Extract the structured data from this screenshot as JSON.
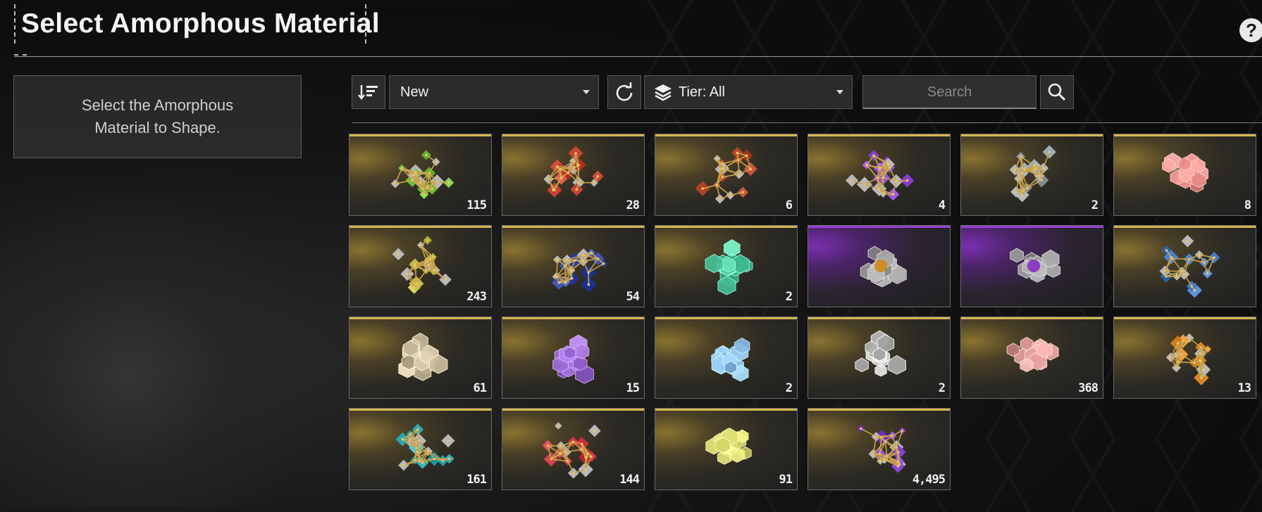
{
  "header": {
    "title": "Select Amorphous Material",
    "help_label": "?"
  },
  "info_panel": {
    "line1": "Select the Amorphous",
    "line2": "Material to Shape."
  },
  "toolbar": {
    "sort_value": "New",
    "tier_label": "Tier: All",
    "search_placeholder": "Search"
  },
  "colors": {
    "gold_rarity": "#d4b650",
    "purple_rarity": "#9a3fd8"
  },
  "materials": [
    {
      "count": "115",
      "style": "net",
      "gem": "#6bbf3a",
      "rarity": "gold"
    },
    {
      "count": "28",
      "style": "net",
      "gem": "#c0392b",
      "rarity": "gold"
    },
    {
      "count": "6",
      "style": "net",
      "gem": "#b5452b",
      "rarity": "gold"
    },
    {
      "count": "4",
      "style": "net",
      "gem": "#8a3fd0",
      "rarity": "gold"
    },
    {
      "count": "2",
      "style": "net",
      "gem": "#8c9aa6",
      "rarity": "gold"
    },
    {
      "count": "8",
      "style": "crystal",
      "gem": "#e88a85",
      "rarity": "gold"
    },
    {
      "count": "243",
      "style": "net",
      "gem": "#b8b23a",
      "rarity": "gold"
    },
    {
      "count": "54",
      "style": "net",
      "gem": "#2d46a8",
      "rarity": "gold"
    },
    {
      "count": "2",
      "style": "crystal",
      "gem": "#4fc9a0",
      "rarity": "gold"
    },
    {
      "count": "",
      "style": "cube",
      "gem": "#d48a1a",
      "rarity": "purple"
    },
    {
      "count": "",
      "style": "cube",
      "gem": "#8a2ec0",
      "rarity": "purple"
    },
    {
      "count": "",
      "style": "net",
      "gem": "#3a70b8",
      "rarity": "gold"
    },
    {
      "count": "61",
      "style": "crystal",
      "gem": "#c9b89a",
      "rarity": "gold"
    },
    {
      "count": "15",
      "style": "crystal",
      "gem": "#9a6ad6",
      "rarity": "gold"
    },
    {
      "count": "2",
      "style": "crystal",
      "gem": "#7fb2e0",
      "rarity": "gold"
    },
    {
      "count": "2",
      "style": "crystal",
      "gem": "#bdbdbd",
      "rarity": "gold"
    },
    {
      "count": "368",
      "style": "crystal",
      "gem": "#e09a95",
      "rarity": "gold"
    },
    {
      "count": "13",
      "style": "net",
      "gem": "#d08020",
      "rarity": "gold"
    },
    {
      "count": "161",
      "style": "net",
      "gem": "#2aa8b0",
      "rarity": "gold"
    },
    {
      "count": "144",
      "style": "net",
      "gem": "#c02a35",
      "rarity": "gold"
    },
    {
      "count": "91",
      "style": "crystal",
      "gem": "#d6d86a",
      "rarity": "gold"
    },
    {
      "count": "4,495",
      "style": "net",
      "gem": "#7a35c8",
      "rarity": "gold"
    }
  ]
}
